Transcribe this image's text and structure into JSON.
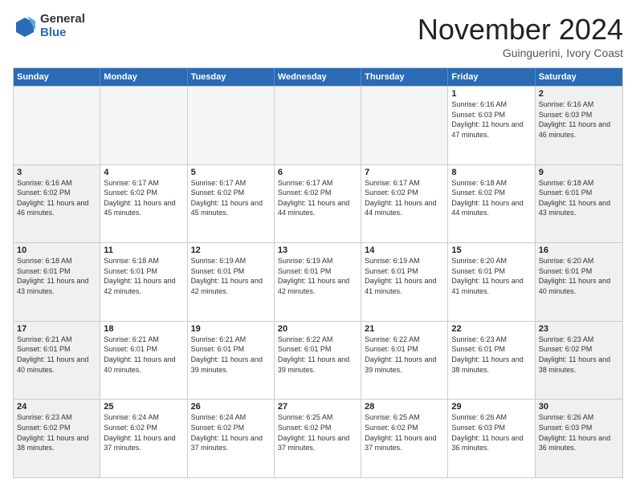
{
  "logo": {
    "general": "General",
    "blue": "Blue"
  },
  "title": "November 2024",
  "location": "Guinguerini, Ivory Coast",
  "header_days": [
    "Sunday",
    "Monday",
    "Tuesday",
    "Wednesday",
    "Thursday",
    "Friday",
    "Saturday"
  ],
  "weeks": [
    [
      {
        "day": "",
        "empty": true
      },
      {
        "day": "",
        "empty": true
      },
      {
        "day": "",
        "empty": true
      },
      {
        "day": "",
        "empty": true
      },
      {
        "day": "",
        "empty": true
      },
      {
        "day": "1",
        "sunrise": "Sunrise: 6:16 AM",
        "sunset": "Sunset: 6:03 PM",
        "daylight": "Daylight: 11 hours and 47 minutes."
      },
      {
        "day": "2",
        "sunrise": "Sunrise: 6:16 AM",
        "sunset": "Sunset: 6:03 PM",
        "daylight": "Daylight: 11 hours and 46 minutes."
      }
    ],
    [
      {
        "day": "3",
        "sunrise": "Sunrise: 6:16 AM",
        "sunset": "Sunset: 6:02 PM",
        "daylight": "Daylight: 11 hours and 46 minutes."
      },
      {
        "day": "4",
        "sunrise": "Sunrise: 6:17 AM",
        "sunset": "Sunset: 6:02 PM",
        "daylight": "Daylight: 11 hours and 45 minutes."
      },
      {
        "day": "5",
        "sunrise": "Sunrise: 6:17 AM",
        "sunset": "Sunset: 6:02 PM",
        "daylight": "Daylight: 11 hours and 45 minutes."
      },
      {
        "day": "6",
        "sunrise": "Sunrise: 6:17 AM",
        "sunset": "Sunset: 6:02 PM",
        "daylight": "Daylight: 11 hours and 44 minutes."
      },
      {
        "day": "7",
        "sunrise": "Sunrise: 6:17 AM",
        "sunset": "Sunset: 6:02 PM",
        "daylight": "Daylight: 11 hours and 44 minutes."
      },
      {
        "day": "8",
        "sunrise": "Sunrise: 6:18 AM",
        "sunset": "Sunset: 6:02 PM",
        "daylight": "Daylight: 11 hours and 44 minutes."
      },
      {
        "day": "9",
        "sunrise": "Sunrise: 6:18 AM",
        "sunset": "Sunset: 6:01 PM",
        "daylight": "Daylight: 11 hours and 43 minutes."
      }
    ],
    [
      {
        "day": "10",
        "sunrise": "Sunrise: 6:18 AM",
        "sunset": "Sunset: 6:01 PM",
        "daylight": "Daylight: 11 hours and 43 minutes."
      },
      {
        "day": "11",
        "sunrise": "Sunrise: 6:18 AM",
        "sunset": "Sunset: 6:01 PM",
        "daylight": "Daylight: 11 hours and 42 minutes."
      },
      {
        "day": "12",
        "sunrise": "Sunrise: 6:19 AM",
        "sunset": "Sunset: 6:01 PM",
        "daylight": "Daylight: 11 hours and 42 minutes."
      },
      {
        "day": "13",
        "sunrise": "Sunrise: 6:19 AM",
        "sunset": "Sunset: 6:01 PM",
        "daylight": "Daylight: 11 hours and 42 minutes."
      },
      {
        "day": "14",
        "sunrise": "Sunrise: 6:19 AM",
        "sunset": "Sunset: 6:01 PM",
        "daylight": "Daylight: 11 hours and 41 minutes."
      },
      {
        "day": "15",
        "sunrise": "Sunrise: 6:20 AM",
        "sunset": "Sunset: 6:01 PM",
        "daylight": "Daylight: 11 hours and 41 minutes."
      },
      {
        "day": "16",
        "sunrise": "Sunrise: 6:20 AM",
        "sunset": "Sunset: 6:01 PM",
        "daylight": "Daylight: 11 hours and 40 minutes."
      }
    ],
    [
      {
        "day": "17",
        "sunrise": "Sunrise: 6:21 AM",
        "sunset": "Sunset: 6:01 PM",
        "daylight": "Daylight: 11 hours and 40 minutes."
      },
      {
        "day": "18",
        "sunrise": "Sunrise: 6:21 AM",
        "sunset": "Sunset: 6:01 PM",
        "daylight": "Daylight: 11 hours and 40 minutes."
      },
      {
        "day": "19",
        "sunrise": "Sunrise: 6:21 AM",
        "sunset": "Sunset: 6:01 PM",
        "daylight": "Daylight: 11 hours and 39 minutes."
      },
      {
        "day": "20",
        "sunrise": "Sunrise: 6:22 AM",
        "sunset": "Sunset: 6:01 PM",
        "daylight": "Daylight: 11 hours and 39 minutes."
      },
      {
        "day": "21",
        "sunrise": "Sunrise: 6:22 AM",
        "sunset": "Sunset: 6:01 PM",
        "daylight": "Daylight: 11 hours and 39 minutes."
      },
      {
        "day": "22",
        "sunrise": "Sunrise: 6:23 AM",
        "sunset": "Sunset: 6:01 PM",
        "daylight": "Daylight: 11 hours and 38 minutes."
      },
      {
        "day": "23",
        "sunrise": "Sunrise: 6:23 AM",
        "sunset": "Sunset: 6:02 PM",
        "daylight": "Daylight: 11 hours and 38 minutes."
      }
    ],
    [
      {
        "day": "24",
        "sunrise": "Sunrise: 6:23 AM",
        "sunset": "Sunset: 6:02 PM",
        "daylight": "Daylight: 11 hours and 38 minutes."
      },
      {
        "day": "25",
        "sunrise": "Sunrise: 6:24 AM",
        "sunset": "Sunset: 6:02 PM",
        "daylight": "Daylight: 11 hours and 37 minutes."
      },
      {
        "day": "26",
        "sunrise": "Sunrise: 6:24 AM",
        "sunset": "Sunset: 6:02 PM",
        "daylight": "Daylight: 11 hours and 37 minutes."
      },
      {
        "day": "27",
        "sunrise": "Sunrise: 6:25 AM",
        "sunset": "Sunset: 6:02 PM",
        "daylight": "Daylight: 11 hours and 37 minutes."
      },
      {
        "day": "28",
        "sunrise": "Sunrise: 6:25 AM",
        "sunset": "Sunset: 6:02 PM",
        "daylight": "Daylight: 11 hours and 37 minutes."
      },
      {
        "day": "29",
        "sunrise": "Sunrise: 6:26 AM",
        "sunset": "Sunset: 6:03 PM",
        "daylight": "Daylight: 11 hours and 36 minutes."
      },
      {
        "day": "30",
        "sunrise": "Sunrise: 6:26 AM",
        "sunset": "Sunset: 6:03 PM",
        "daylight": "Daylight: 11 hours and 36 minutes."
      }
    ]
  ]
}
